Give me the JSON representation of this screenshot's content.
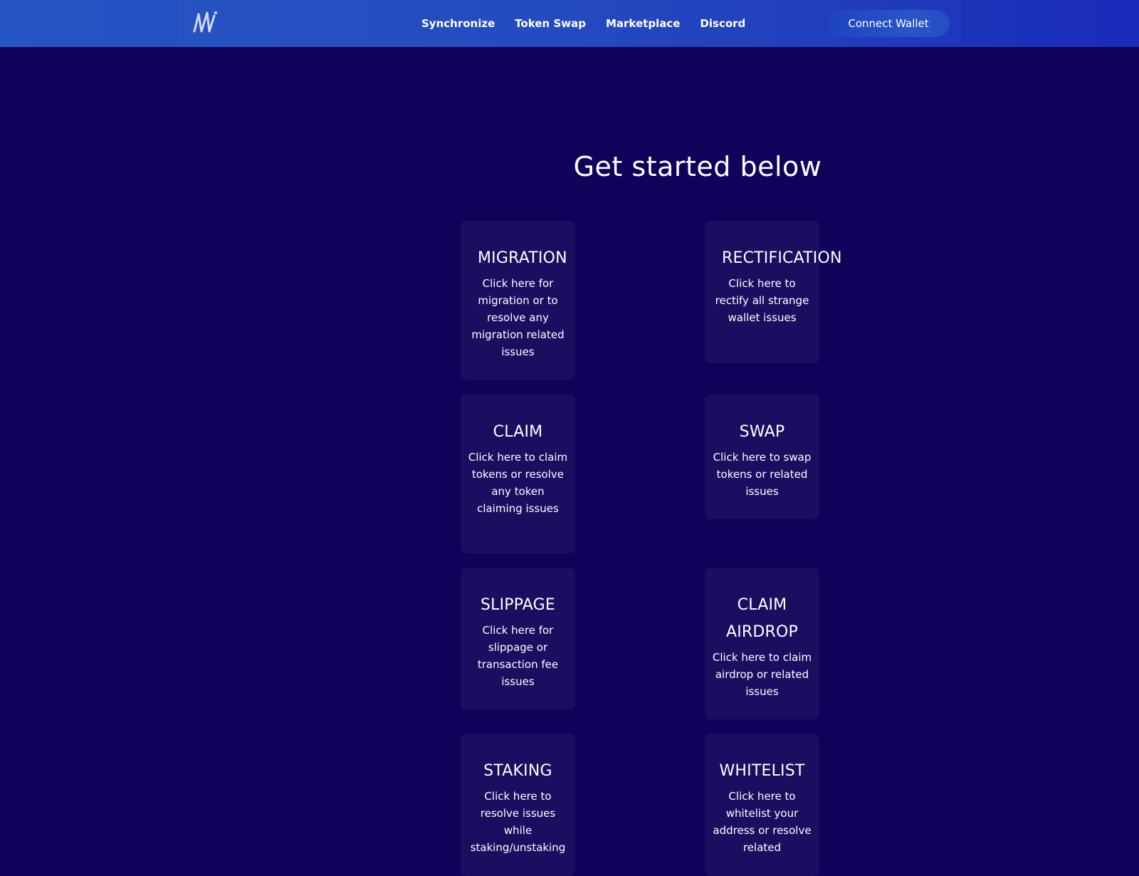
{
  "nav": {
    "links": [
      "Synchronize",
      "Token Swap",
      "Marketplace",
      "Discord"
    ],
    "connect_label": "Connect Wallet"
  },
  "main": {
    "heading": "Get started below",
    "cards": [
      {
        "title": "MIGRATION",
        "desc": "Click here for migration or to resolve any migration related issues"
      },
      {
        "title": "RECTIFICATION",
        "desc": "Click here to rectify all strange wallet issues"
      },
      {
        "title": "CLAIM",
        "desc": "Click here to claim tokens or resolve any token claiming issues"
      },
      {
        "title": "SWAP",
        "desc": "Click here to swap tokens or related issues"
      },
      {
        "title": "SLIPPAGE",
        "desc": "Click here for slippage or transaction fee issues"
      },
      {
        "title": "CLAIM AIRDROP",
        "desc": "Click here to claim airdrop or related issues"
      },
      {
        "title": "STAKING",
        "desc": "Click here to resolve issues while staking/unstaking"
      },
      {
        "title": "WHITELIST",
        "desc": "Click here to whitelist your address or resolve related"
      }
    ]
  },
  "colors": {
    "background": "#10025b",
    "card": "#1a0e61",
    "nav_start": "#2555c3",
    "nav_end": "#1a2bb9"
  },
  "icons": {
    "logo": "w-logo-icon"
  }
}
